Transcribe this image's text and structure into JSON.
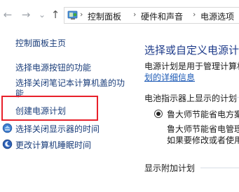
{
  "navigation": {
    "back_glyph": "←",
    "forward_glyph": "→",
    "recent_glyph": "⌄",
    "up_glyph": "↑"
  },
  "address_bar": {
    "icon": "control-panel-icon",
    "separator": "›",
    "breadcrumbs": [
      "控制面板",
      "硬件和声音",
      "电源选项"
    ]
  },
  "left_pane": {
    "home_link": "控制面板主页",
    "links": [
      "选择电源按钮的功能",
      "选择关闭笔记本计算机盖的功",
      "能",
      "创建电源计划",
      "选择关闭显示器的时间",
      "更改计算机睡眠时间"
    ],
    "highlight_color": "#e8202a"
  },
  "main": {
    "title": "选择或自定义电源计",
    "description": "电源计划是用于管理计算机",
    "details_link": "划的详细信息",
    "battery_section_label": "电池指示器上显示的计划",
    "plan_name": "鲁大师节能省电方案",
    "plan_desc_line1": "鲁大师节能省电管理",
    "plan_desc_line2": "如果要修改或者使用",
    "additional_section_label": "显示附加计划"
  }
}
